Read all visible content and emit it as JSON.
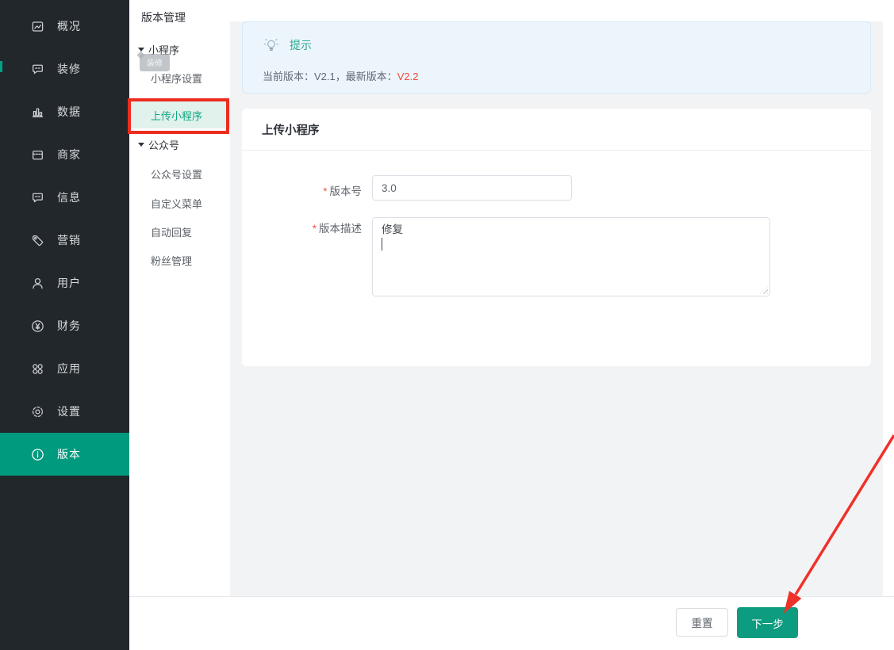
{
  "theme": {
    "sidebar_bg": "#22272c",
    "accent_green": "#009a7e",
    "button_green": "#0e9c80",
    "submenu_active_color": "#0fa57f",
    "submenu_active_bg": "#e1f1ec",
    "tip_bg": "#edf5fc",
    "tip_border": "#d7e9f8",
    "tip_title_color": "#2ea98d",
    "highlight_red": "#f4483c",
    "annotation_red": "#ec2d1e"
  },
  "sidebar": {
    "items": [
      {
        "label": "概况",
        "icon": "overview-icon"
      },
      {
        "label": "装修",
        "icon": "decorate-icon"
      },
      {
        "label": "数据",
        "icon": "data-icon"
      },
      {
        "label": "商家",
        "icon": "merchant-icon"
      },
      {
        "label": "信息",
        "icon": "message-icon"
      },
      {
        "label": "营销",
        "icon": "marketing-icon"
      },
      {
        "label": "用户",
        "icon": "user-icon"
      },
      {
        "label": "财务",
        "icon": "finance-icon"
      },
      {
        "label": "应用",
        "icon": "apps-icon"
      },
      {
        "label": "设置",
        "icon": "settings-icon"
      },
      {
        "label": "版本",
        "icon": "version-icon"
      }
    ],
    "active_item": "版本"
  },
  "submenu": {
    "title": "版本管理",
    "group1": {
      "label": "小程序"
    },
    "group2": {
      "label": "公众号"
    },
    "items": [
      {
        "label": "小程序设置"
      },
      {
        "label": "上传小程序",
        "active": true
      },
      {
        "label": "公众号设置"
      },
      {
        "label": "自定义菜单"
      },
      {
        "label": "自动回复"
      },
      {
        "label": "粉丝管理"
      }
    ],
    "drag_ghost_label": "装修"
  },
  "tip": {
    "icon": "lightbulb-icon",
    "title": "提示",
    "text_prefix": "当前版本：V2.1，最新版本：",
    "text_highlight": "V2.2"
  },
  "form": {
    "title": "上传小程序",
    "fields": [
      {
        "label": "版本号",
        "required_mark": "*",
        "value": "3.0"
      },
      {
        "label": "版本描述",
        "required_mark": "*",
        "value": "修复"
      }
    ]
  },
  "footer": {
    "reset_label": "重置",
    "next_label": "下一步"
  }
}
